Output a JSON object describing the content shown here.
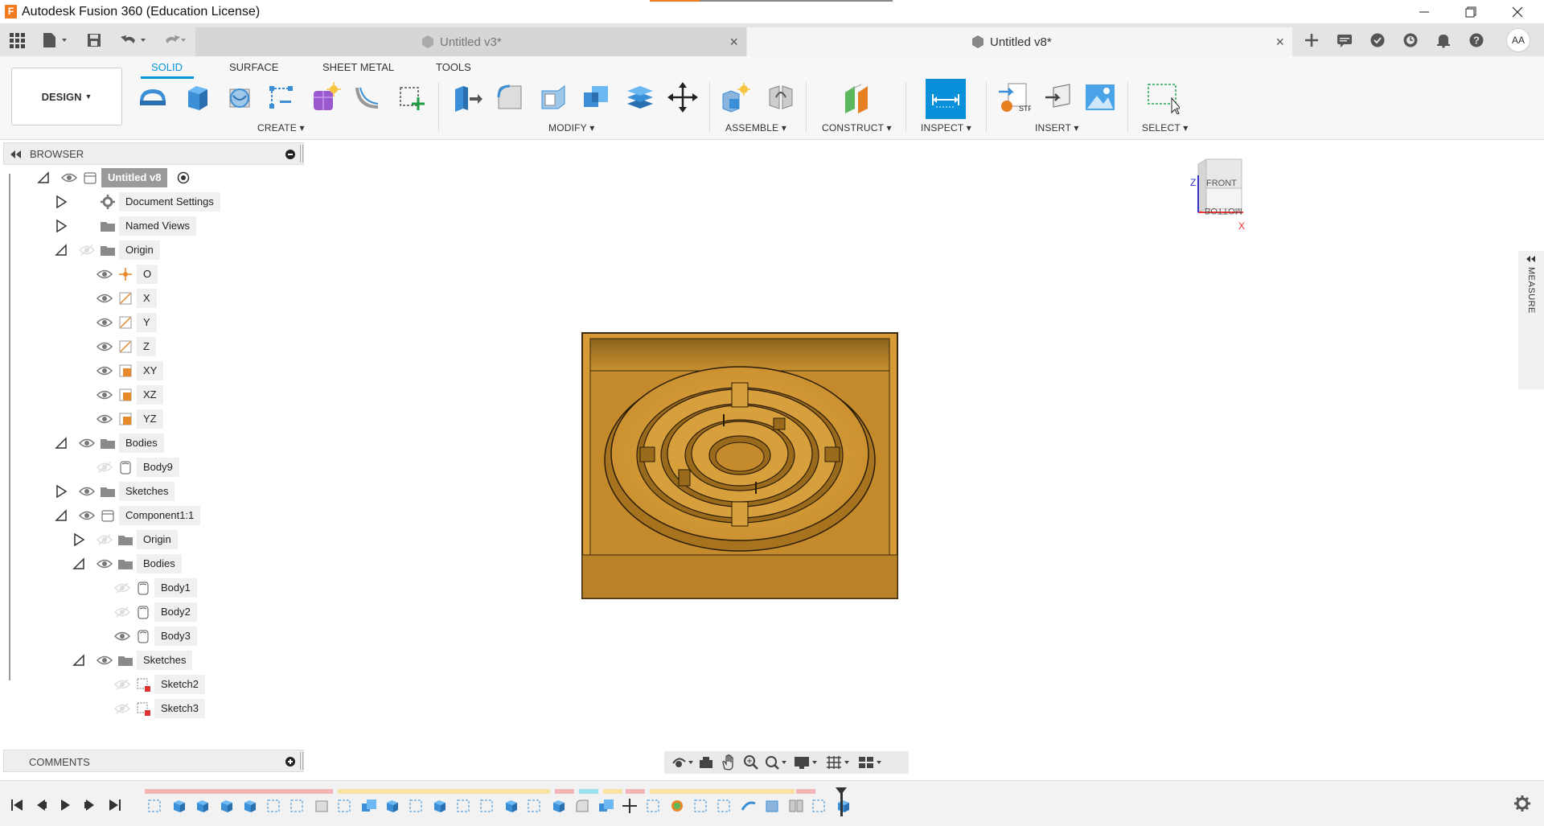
{
  "window": {
    "app_icon_letter": "F",
    "title": "Autodesk Fusion 360 (Education License)",
    "controls": [
      "minimize",
      "restore",
      "close"
    ]
  },
  "tabs": [
    {
      "label": "Untitled v3*",
      "active": false
    },
    {
      "label": "Untitled v8*",
      "active": true
    }
  ],
  "quick_access": [
    "data-panel-icon",
    "file-icon",
    "save-icon",
    "undo-icon",
    "redo-icon"
  ],
  "right_icons": [
    "new-tab-icon",
    "comments-icon",
    "online-status-icon",
    "job-status-icon",
    "notifications-icon",
    "help-icon"
  ],
  "user_initials": "AA",
  "toolbar": {
    "workspace": "DESIGN",
    "workspace_tabs": [
      "SOLID",
      "SURFACE",
      "SHEET METAL",
      "TOOLS"
    ],
    "active_tab": "SOLID",
    "groups": {
      "create": "CREATE",
      "modify": "MODIFY",
      "assemble": "ASSEMBLE",
      "construct": "CONSTRUCT",
      "inspect": "INSPECT",
      "insert": "INSERT",
      "select": "SELECT"
    }
  },
  "browser": {
    "title": "BROWSER",
    "items": [
      {
        "label": "Untitled v8",
        "icon": "component-icon",
        "visible": true,
        "expanded": true,
        "root": true
      },
      {
        "label": "Document Settings",
        "icon": "gear-icon",
        "expanded": false
      },
      {
        "label": "Named Views",
        "icon": "folder-icon",
        "expanded": false
      },
      {
        "label": "Origin",
        "icon": "folder-icon",
        "visible": false,
        "expanded": true
      },
      {
        "label": "O",
        "icon": "origin-point-icon",
        "visible": true
      },
      {
        "label": "X",
        "icon": "axis-icon",
        "visible": true
      },
      {
        "label": "Y",
        "icon": "axis-icon",
        "visible": true
      },
      {
        "label": "Z",
        "icon": "axis-icon",
        "visible": true
      },
      {
        "label": "XY",
        "icon": "plane-icon",
        "visible": true
      },
      {
        "label": "XZ",
        "icon": "plane-icon",
        "visible": true
      },
      {
        "label": "YZ",
        "icon": "plane-icon",
        "visible": true
      },
      {
        "label": "Bodies",
        "icon": "folder-icon",
        "visible": true,
        "expanded": true
      },
      {
        "label": "Body9",
        "icon": "body-icon",
        "visible": false
      },
      {
        "label": "Sketches",
        "icon": "folder-icon",
        "visible": true,
        "expanded": false
      },
      {
        "label": "Component1:1",
        "icon": "component-icon",
        "visible": true,
        "expanded": true
      },
      {
        "label": "Origin",
        "icon": "folder-icon",
        "visible": false,
        "expanded": false
      },
      {
        "label": "Bodies",
        "icon": "folder-icon",
        "visible": true,
        "expanded": true
      },
      {
        "label": "Body1",
        "icon": "body-icon",
        "visible": false
      },
      {
        "label": "Body2",
        "icon": "body-icon",
        "visible": false
      },
      {
        "label": "Body3",
        "icon": "body-icon",
        "visible": true
      },
      {
        "label": "Sketches",
        "icon": "folder-icon",
        "visible": true,
        "expanded": true
      },
      {
        "label": "Sketch2",
        "icon": "sketch-icon",
        "visible": false
      },
      {
        "label": "Sketch3",
        "icon": "sketch-icon",
        "visible": false
      }
    ]
  },
  "comments": {
    "title": "COMMENTS"
  },
  "viewcube": {
    "front": "FRONT",
    "bottom": "BOTTOM",
    "axis_z": "Z",
    "axis_x": "X"
  },
  "measure_panel": "MEASURE",
  "colors": {
    "accent": "#0696d7",
    "model": "#d9a13a",
    "fusion_orange": "#f37b20"
  }
}
